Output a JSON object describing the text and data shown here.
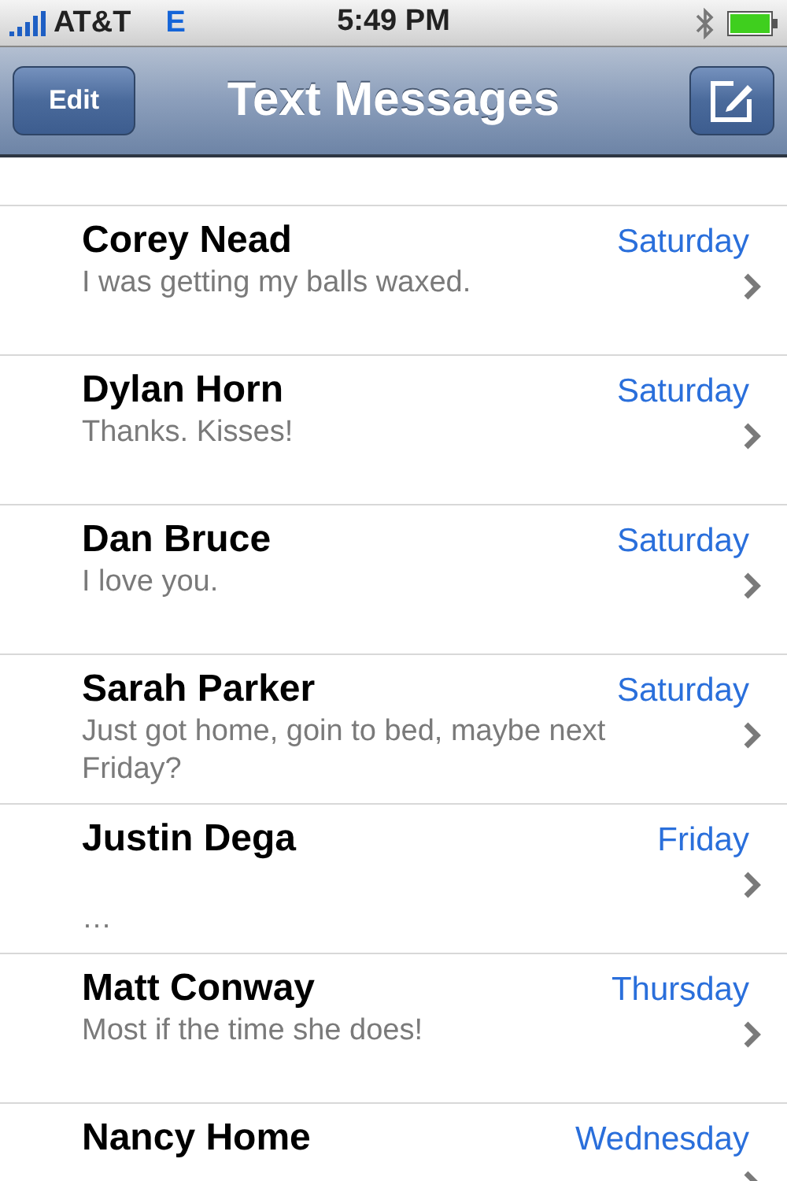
{
  "status_bar": {
    "carrier": "AT&T",
    "network": "E",
    "time": "5:49 PM"
  },
  "nav_bar": {
    "left_button": "Edit",
    "title": "Text Messages"
  },
  "messages": [
    {
      "name": "Corey Nead",
      "date": "Saturday",
      "preview": "I was getting my balls waxed."
    },
    {
      "name": "Dylan Horn",
      "date": "Saturday",
      "preview": "Thanks. Kisses!"
    },
    {
      "name": "Dan Bruce",
      "date": "Saturday",
      "preview": "I love you."
    },
    {
      "name": "Sarah Parker",
      "date": "Saturday",
      "preview": "Just got home, goin to bed, maybe next Friday?"
    },
    {
      "name": "Justin Dega",
      "date": "Friday",
      "preview": "\n…"
    },
    {
      "name": "Matt Conway",
      "date": "Thursday",
      "preview": "Most if the time she does!"
    },
    {
      "name": "Nancy Home",
      "date": "Wednesday"
    }
  ]
}
